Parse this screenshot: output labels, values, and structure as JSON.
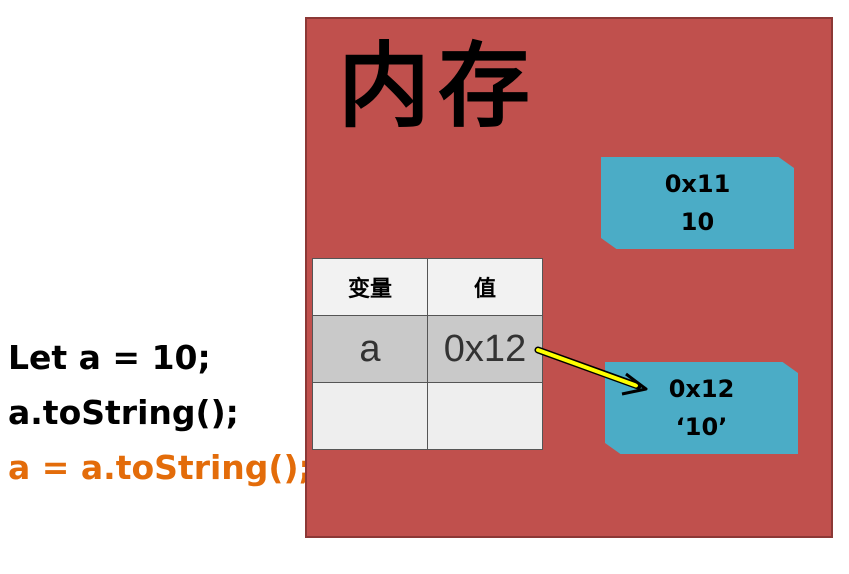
{
  "code": {
    "lines": [
      "Let a = 10;",
      "a.toString();",
      "a = a.toString();"
    ]
  },
  "memory": {
    "title": "内存",
    "background_color": "#c0504d",
    "table": {
      "headers": [
        "变量",
        "值"
      ],
      "rows": [
        {
          "name": "a",
          "value": "0x12"
        },
        {
          "name": "",
          "value": ""
        }
      ]
    },
    "blocks": [
      {
        "address": "0x11",
        "value": "10"
      },
      {
        "address": "0x12",
        "value": "‘10’"
      }
    ],
    "block_color": "#4bacc6",
    "arrow_color": "#ffff00"
  }
}
